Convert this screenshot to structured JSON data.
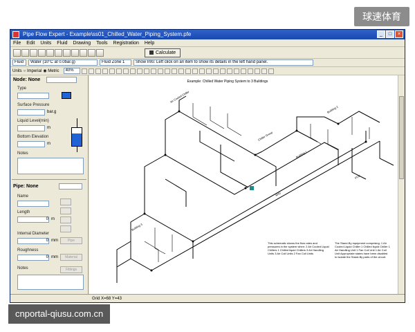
{
  "watermarks": {
    "top": "球速体育",
    "bottom": "cnportal-qiusu.com.cn"
  },
  "window": {
    "title": "Pipe Flow Expert - Example\\ss01_Chilled_Water_Piping_System.pfe",
    "controls": [
      "_",
      "□",
      "×"
    ]
  },
  "menu": [
    "File",
    "Edit",
    "Units",
    "Fluid",
    "Drawing",
    "Tools",
    "Registration",
    "Help"
  ],
  "toolbar": {
    "calculate_label": "Calculate"
  },
  "fluid_bar": {
    "fluid_button": "Fluid",
    "fluid_value": "Water (10°C at 0.0bar.g)",
    "zone_value": "Fluid Zone 1",
    "info_text": "Show Info: Left click on an item to show its details in the left hand panel."
  },
  "units_bar": {
    "units_label": "Units",
    "imperial_label": "Imperial",
    "metric_label": "Metric",
    "zoom_value": "40%"
  },
  "node_panel": {
    "header": "Node: None",
    "type_label": "Type",
    "surface_pressure_label": "Surface Pressure",
    "surface_pressure_unit": "bar.g",
    "liquid_level_label": "Liquid Level(min)",
    "liquid_level_unit": "m",
    "bottom_elevation_label": "Bottom Elevation",
    "bottom_elevation_unit": "m",
    "notes_label": "Notes"
  },
  "pipe_panel": {
    "header": "Pipe: None",
    "name_label": "Name",
    "length_label": "Length",
    "length_value": "0",
    "length_unit": "m",
    "internal_diameter_label": "Internal Diameter",
    "internal_diameter_value": "0",
    "internal_diameter_unit": "mm",
    "roughness_label": "Roughness",
    "roughness_value": "0",
    "roughness_unit": "mm",
    "notes_label": "Notes",
    "btn_pipe_label": "Pipe",
    "btn_material_label": "Material",
    "btn_fittings_label": "Fittings"
  },
  "drawing": {
    "title": "Example: Chilled Water Piping System to 3 Buildings",
    "note_left": "This schematic shows the flow rates and pressures in the system when: 2 Air Cooled Liquid Chillers 1 Chilled liquid Chillers 3 Air Handling Units 3 Air Coil Units 2 Fan Coil Units",
    "note_right": "The Stand-By equipment comprising: 1 Air Cooled Liquid Chiller 1 Chilled liquid Chiller 1 Air Handling Unit 1 Fan Coil Unit 1 Air Coil Unit Appropriate states have been disabled to isolate the Stand-By parts of the circuit.",
    "labels": [
      "Air Cooled Chiller",
      "Chiller Group",
      "Building 1",
      "Building 2",
      "Building 3",
      "AHU",
      "FCU"
    ]
  },
  "status": {
    "coords": "Grid X=68 Y=43"
  }
}
